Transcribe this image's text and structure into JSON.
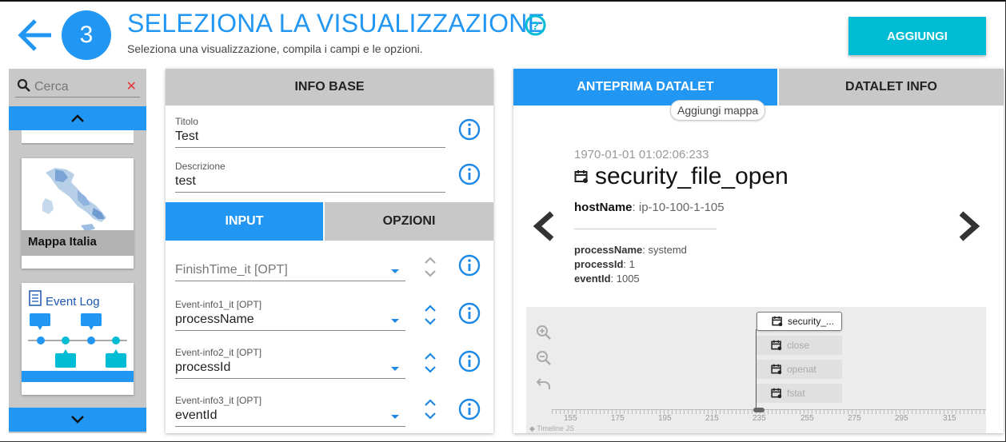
{
  "header": {
    "step_number": "3",
    "title": "SELEZIONA LA VISUALIZZAZIONE",
    "subtitle": "Seleziona una visualizzazione, compila i campi e le opzioni.",
    "add_button": "AGGIUNGI",
    "accent_color": "#2196f3",
    "add_button_color": "#00bcd4"
  },
  "sidebar": {
    "search_placeholder": "Cerca",
    "cards": [
      {
        "label": "Mappa Italia",
        "icon": "italy-map-thumbnail"
      },
      {
        "label": "Event Log",
        "icon": "event-log-thumbnail"
      }
    ]
  },
  "info_base": {
    "header": "INFO BASE",
    "titolo_label": "Titolo",
    "titolo_value": "Test",
    "descrizione_label": "Descrizione",
    "descrizione_value": "test",
    "tabs": [
      "INPUT",
      "OPZIONI"
    ],
    "active_tab": "INPUT",
    "selects": [
      {
        "label": "",
        "value": "FinishTime_it [OPT]"
      },
      {
        "label": "Event-info1_it [OPT]",
        "value": "processName"
      },
      {
        "label": "Event-info2_it [OPT]",
        "value": "processId"
      },
      {
        "label": "Event-info3_it [OPT]",
        "value": "eventId"
      }
    ]
  },
  "preview": {
    "tabs": [
      "ANTEPRIMA DATALET",
      "DATALET INFO"
    ],
    "active_tab": "ANTEPRIMA DATALET",
    "add_map": "Aggiungi mappa",
    "event": {
      "date": "1970-01-01 01:02:06:233",
      "title": "security_file_open",
      "host_key": "hostName",
      "host_value": ": ip-10-100-1-105",
      "details": [
        {
          "key": "processName",
          "value": ": systemd"
        },
        {
          "key": "processId",
          "value": ": 1"
        },
        {
          "key": "eventId",
          "value": ": 1005"
        }
      ]
    },
    "timeline": {
      "items": [
        "security_...",
        "close",
        "openat",
        "fstat"
      ],
      "ticks": [
        "155",
        "175",
        "195",
        "215",
        "235",
        "255",
        "275",
        "295",
        "315"
      ],
      "credit": "Timeline JS"
    }
  }
}
